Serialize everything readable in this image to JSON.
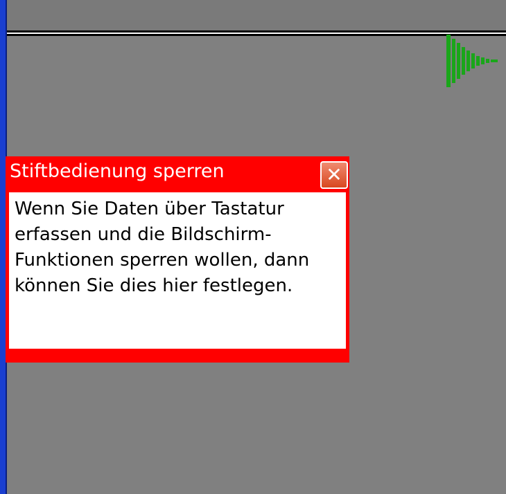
{
  "tooltip": {
    "title": "Stiftbedienung sperren",
    "close_symbol": "✕",
    "close_icon": "close-icon",
    "body": "Wenn Sie Daten über Tastatur erfassen und die Bildschirm-Funktionen sperren wollen, dann können Sie dies hier festlegen."
  },
  "indicator": {
    "icon": "play-arrow-icon",
    "color": "#19a619"
  },
  "colors": {
    "tooltip_background": "#ff0000",
    "screen_background": "#808080",
    "left_edge": "#1a3fd0"
  }
}
